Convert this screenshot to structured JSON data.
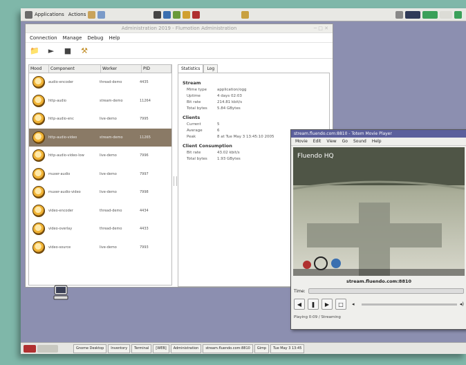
{
  "top_panel": {
    "applications": "Applications",
    "actions": "Actions"
  },
  "main_window": {
    "title": "Administration 2019 - Flumotion Administration",
    "menu": [
      "Connection",
      "Manage",
      "Debug",
      "Help"
    ],
    "columns": [
      "Mood",
      "Component",
      "Worker",
      "PID"
    ],
    "components": [
      {
        "name": "audio-encoder",
        "worker": "thread-demo",
        "pid": "4435"
      },
      {
        "name": "http-audio",
        "worker": "stream-demo",
        "pid": "11264"
      },
      {
        "name": "http-audio-enc",
        "worker": "live-demo",
        "pid": "7995"
      },
      {
        "name": "http-audio-video",
        "worker": "stream-demo",
        "pid": "11265"
      },
      {
        "name": "http-audio-video-low",
        "worker": "live-demo",
        "pid": "7996"
      },
      {
        "name": "muxer-audio",
        "worker": "live-demo",
        "pid": "7997"
      },
      {
        "name": "muxer-audio-video",
        "worker": "live-demo",
        "pid": "7998"
      },
      {
        "name": "video-encoder",
        "worker": "thread-demo",
        "pid": "4434"
      },
      {
        "name": "video-overlay",
        "worker": "thread-demo",
        "pid": "4433"
      },
      {
        "name": "video-source",
        "worker": "live-demo",
        "pid": "7993"
      }
    ],
    "tabs": [
      "Statistics",
      "Log"
    ],
    "stats": {
      "stream_header": "Stream",
      "stream": [
        {
          "k": "Mime type",
          "v": "application/ogg"
        },
        {
          "k": "Uptime",
          "v": "4 days 02:03"
        },
        {
          "k": "Bit rate",
          "v": "214.81 kbit/s"
        },
        {
          "k": "Total bytes",
          "v": "5.84 GBytes"
        }
      ],
      "clients_header": "Clients",
      "clients": [
        {
          "k": "Current",
          "v": "5"
        },
        {
          "k": "Average",
          "v": "6"
        },
        {
          "k": "Peak",
          "v": "8 at Tue May 3 13:45:10 2005"
        }
      ],
      "consumption_header": "Client Consumption",
      "consumption": [
        {
          "k": "Bit rate",
          "v": "43.02 kbit/s"
        },
        {
          "k": "Total bytes",
          "v": "1.93 GBytes"
        }
      ]
    }
  },
  "player": {
    "title": "stream.fluendo.com:8810 - Totem Movie Player",
    "menu": [
      "Movie",
      "Edit",
      "View",
      "Go",
      "Sound",
      "Help"
    ],
    "video_caption": "Fluendo HQ",
    "url": "stream.fluendo.com:8810",
    "time_label": "Time:",
    "status": "Playing   0:09 / Streaming"
  },
  "bottom_panel": {
    "items": [
      "Gnome Desktop",
      "Inventory",
      "Terminal",
      "[WEB]",
      "Administration",
      "stream.fluendo.com:8810",
      "Gimp",
      "Tue May 3 13:45"
    ]
  },
  "colors": {
    "desktop": "#8c8fb0",
    "selected_row": "#8a7a66",
    "player_title": "#5b5f9c"
  }
}
